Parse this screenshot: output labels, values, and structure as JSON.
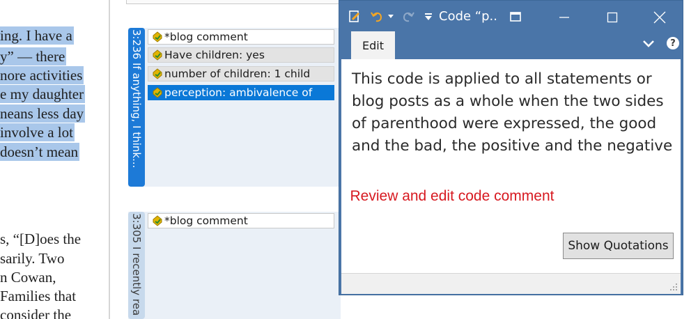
{
  "document": {
    "lines_top": [
      "ing. I have a",
      "y” — there",
      "nore activities",
      "e my daughter",
      "neans less day",
      " involve a lot",
      " doesn’t mean"
    ],
    "lines_bottom": [
      "s, “[D]oes the",
      "sarily. Two",
      "n Cowan,",
      "Families that",
      " consider the"
    ],
    "highlight_color": "#a9c7ea"
  },
  "margin": {
    "quotation1": {
      "label": "3:236 If anything, I think...",
      "codes": [
        "*blog comment",
        "Have children: yes",
        "number of children: 1 child",
        "perception: ambivalence of"
      ],
      "selected_index": 3
    },
    "quotation2": {
      "label": "3:305 I recently rea",
      "codes": [
        "*blog comment"
      ]
    },
    "code_icon": "code-tag-icon",
    "accent": "#1d7ad7"
  },
  "window": {
    "title": "Code “p..",
    "tab": "Edit",
    "comment": "This code is applied to all statements or blog posts as a whole when the two sides of parenthood were expressed, the good and the bad, the positive and the negative",
    "annotation": "Review and edit code comment",
    "show_quotations": "Show Quotations",
    "help_label": "?",
    "titlebar_color": "#4a75a8",
    "annotation_color": "#d71920"
  }
}
